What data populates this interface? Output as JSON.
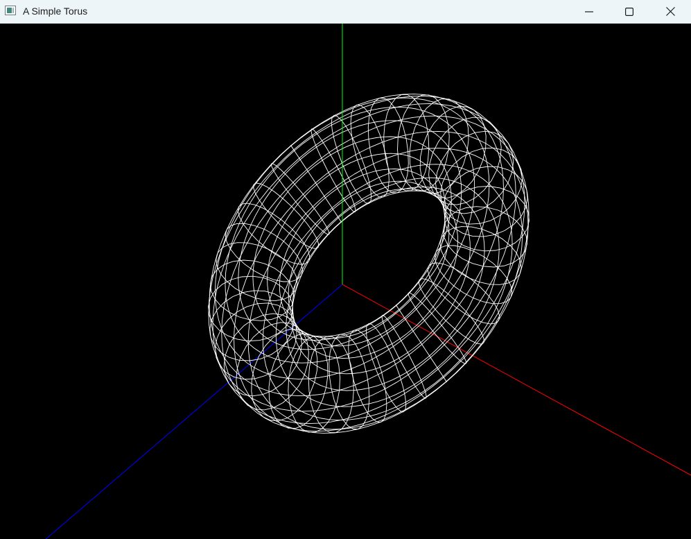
{
  "window": {
    "title": "A Simple Torus",
    "app_icon": "opengl-window-icon",
    "controls": {
      "minimize_icon": "minimize-icon",
      "maximize_icon": "maximize-icon",
      "close_icon": "close-icon"
    }
  },
  "scene": {
    "background": "#000000",
    "axes": {
      "x": {
        "color": "#ff0000"
      },
      "y": {
        "color": "#00ff00"
      },
      "z": {
        "color": "#0000ff"
      }
    },
    "torus": {
      "render_mode": "wireframe",
      "color": "#ffffff"
    }
  }
}
